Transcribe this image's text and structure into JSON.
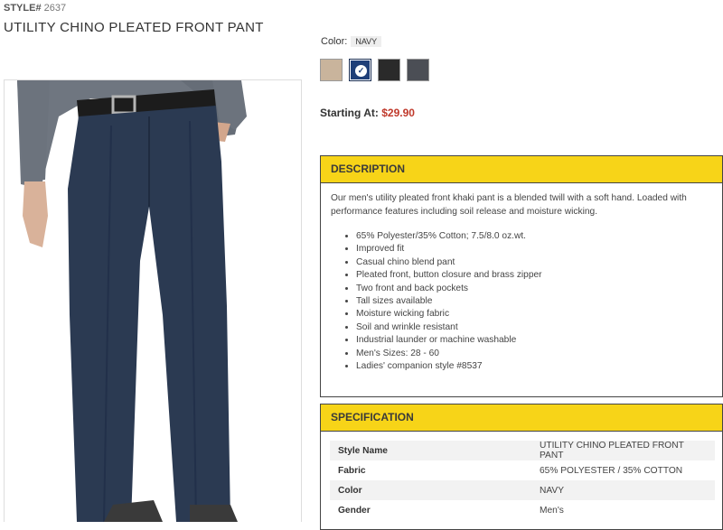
{
  "product": {
    "style_label": "STYLE#",
    "style_number": "2637",
    "title": "UTILITY CHINO PLEATED FRONT PANT"
  },
  "color": {
    "label": "Color:",
    "selected": "NAVY",
    "swatches": [
      {
        "name": "khaki",
        "color": "#c9b49c"
      },
      {
        "name": "navy",
        "color": "#1f3f78",
        "selected": true
      },
      {
        "name": "black",
        "color": "#2a2a2a"
      },
      {
        "name": "charcoal",
        "color": "#4b4e55"
      }
    ]
  },
  "price": {
    "label": "Starting At:",
    "value": "$29.90",
    "color": "#c0392b"
  },
  "description": {
    "heading": "DESCRIPTION",
    "intro": "Our men's utility pleated front khaki pant is a blended twill with a soft hand. Loaded with performance features including soil release and moisture wicking.",
    "bullets": [
      "65% Polyester/35% Cotton; 7.5/8.0 oz.wt.",
      "Improved fit",
      "Casual chino blend pant",
      "Pleated front, button closure and brass zipper",
      "Two front and back pockets",
      "Tall sizes available",
      "Moisture wicking fabric",
      "Soil and wrinkle resistant",
      "Industrial launder or machine washable",
      "Men's Sizes: 28 - 60",
      "Ladies' companion style #8537"
    ]
  },
  "specification": {
    "heading": "SPECIFICATION",
    "rows": [
      {
        "key": "Style Name",
        "value": "UTILITY CHINO PLEATED FRONT PANT"
      },
      {
        "key": "Fabric",
        "value": "65% POLYESTER / 35% COTTON"
      },
      {
        "key": "Color",
        "value": "NAVY"
      },
      {
        "key": "Gender",
        "value": "Men's"
      }
    ]
  },
  "theme": {
    "panel_header_bg": "#f7d418",
    "pant_color": "#2b3a52",
    "shirt_color": "#6f7680"
  }
}
